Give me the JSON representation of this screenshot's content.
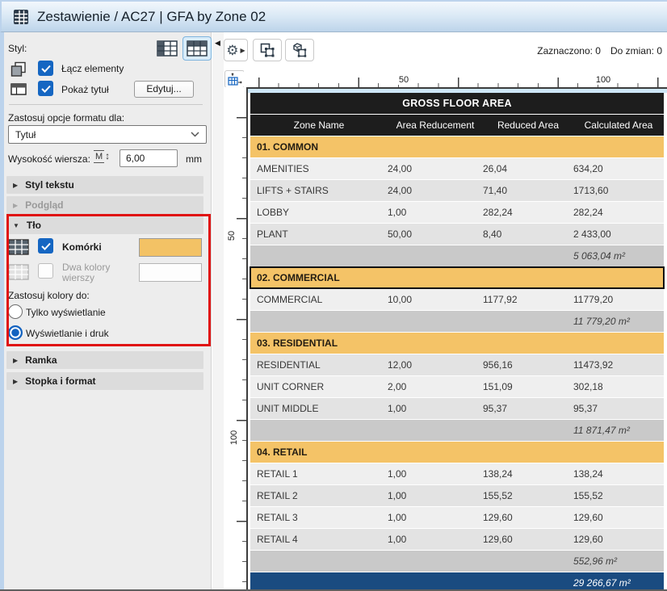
{
  "window": {
    "title": "Zestawienie / AC27 | GFA by Zone 02"
  },
  "status": {
    "selected": "Zaznaczono: 0",
    "to_change": "Do zmian: 0"
  },
  "panel": {
    "style_label": "Styl:",
    "link_elements": "Łącz elementy",
    "show_title": "Pokaż tytuł",
    "edit_button": "Edytuj...",
    "apply_format_label": "Zastosuj opcje formatu dla:",
    "format_target": "Tytuł",
    "row_height_label": "Wysokość wiersza:",
    "row_height_value": "6,00",
    "row_height_unit": "mm",
    "section_text_style": "Styl tekstu",
    "section_preview": "Podgląd",
    "section_background": "Tło",
    "section_frame": "Ramka",
    "section_footer": "Stopka i format",
    "cells_label": "Komórki",
    "two_colors_line1": "Dwa kolory",
    "two_colors_line2": "wierszy",
    "cell_color": "#F3C265",
    "apply_colors_label": "Zastosuj kolory do:",
    "radio_display_only": "Tylko wyświetlanie",
    "radio_display_print": "Wyświetlanie i druk"
  },
  "ruler": {
    "h": [
      "50",
      "100"
    ],
    "v": [
      "50",
      "100"
    ]
  },
  "schedule": {
    "title": "GROSS FLOOR AREA",
    "col1": "Zone Name",
    "col2": "Area Reducement",
    "col3": "Reduced Area",
    "col4": "Calculated Area",
    "rows": [
      {
        "c1": "01. COMMON"
      },
      {
        "c1": "AMENITIES",
        "c2": "24,00",
        "c3": "26,04",
        "c4": "634,20"
      },
      {
        "c1": "LIFTS + STAIRS",
        "c2": "24,00",
        "c3": "71,40",
        "c4": "1713,60"
      },
      {
        "c1": "LOBBY",
        "c2": "1,00",
        "c3": "282,24",
        "c4": "282,24"
      },
      {
        "c1": "PLANT",
        "c2": "50,00",
        "c3": "8,40",
        "c4": "2 433,00"
      },
      {
        "c4": "5 063,04 m²"
      },
      {
        "c1": "02. COMMERCIAL"
      },
      {
        "c1": "COMMERCIAL",
        "c2": "10,00",
        "c3": "1177,92",
        "c4": "11779,20"
      },
      {
        "c4": "11 779,20 m²"
      },
      {
        "c1": "03. RESIDENTIAL"
      },
      {
        "c1": "RESIDENTIAL",
        "c2": "12,00",
        "c3": "956,16",
        "c4": "11473,92"
      },
      {
        "c1": "UNIT CORNER",
        "c2": "2,00",
        "c3": "151,09",
        "c4": "302,18"
      },
      {
        "c1": "UNIT MIDDLE",
        "c2": "1,00",
        "c3": "95,37",
        "c4": "95,37"
      },
      {
        "c4": "11 871,47 m²"
      },
      {
        "c1": "04. RETAIL"
      },
      {
        "c1": "RETAIL 1",
        "c2": "1,00",
        "c3": "138,24",
        "c4": "138,24"
      },
      {
        "c1": "RETAIL 2",
        "c2": "1,00",
        "c3": "155,52",
        "c4": "155,52"
      },
      {
        "c1": "RETAIL 3",
        "c2": "1,00",
        "c3": "129,60",
        "c4": "129,60"
      },
      {
        "c1": "RETAIL 4",
        "c2": "1,00",
        "c3": "129,60",
        "c4": "129,60"
      },
      {
        "c4": "552,96 m²"
      },
      {
        "c4": "29 266,67 m²"
      }
    ]
  }
}
